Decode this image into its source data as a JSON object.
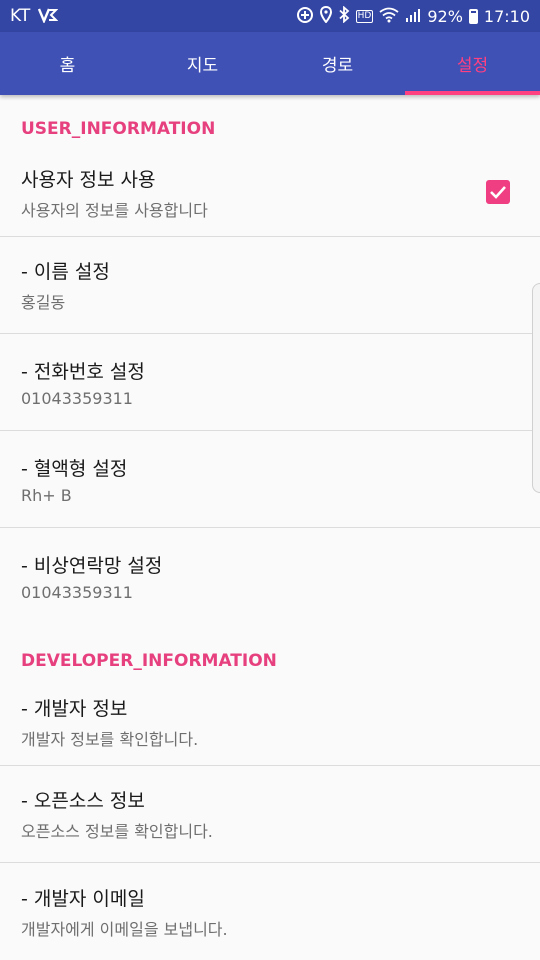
{
  "status_bar": {
    "carrier": "KT",
    "battery_percent": "92%",
    "time": "17:10",
    "hd_label": "HD",
    "icons": [
      "v3-app-icon",
      "data-saver-icon",
      "location-icon",
      "bluetooth-icon",
      "hd-icon",
      "wifi-icon",
      "signal-icon",
      "battery-icon"
    ]
  },
  "tabs": [
    {
      "label": "홈",
      "active": false
    },
    {
      "label": "지도",
      "active": false
    },
    {
      "label": "경로",
      "active": false
    },
    {
      "label": "설정",
      "active": true
    }
  ],
  "sections": [
    {
      "category": "USER_INFORMATION",
      "items": [
        {
          "title": "사용자 정보 사용",
          "summary": "사용자의 정보를 사용합니다",
          "checked": true
        },
        {
          "title": "- 이름 설정",
          "summary": "홍길동"
        },
        {
          "title": "- 전화번호 설정",
          "summary": "01043359311"
        },
        {
          "title": "- 혈액형 설정",
          "summary": "Rh+ B"
        },
        {
          "title": "- 비상연락망 설정",
          "summary": "01043359311"
        }
      ]
    },
    {
      "category": "DEVELOPER_INFORMATION",
      "items": [
        {
          "title": "- 개발자 정보",
          "summary": "개발자 정보를 확인합니다."
        },
        {
          "title": "- 오픈소스 정보",
          "summary": "오픈소스 정보를 확인합니다."
        },
        {
          "title": "- 개발자 이메일",
          "summary": "개발자에게 이메일을 보냅니다."
        }
      ]
    }
  ],
  "colors": {
    "status_bar": "#3446a4",
    "toolbar": "#3f51b5",
    "accent": "#ff4081",
    "category_text": "#e7407f"
  }
}
